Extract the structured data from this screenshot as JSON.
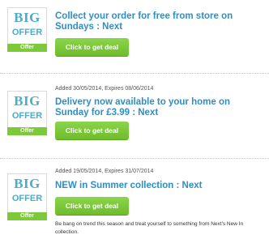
{
  "deals": [
    {
      "badge_big": "BIG",
      "badge_offer": "OFFER",
      "badge_tag": "Offer",
      "title": "Collect your order for free from store on Sundays : Next",
      "button": "Click to get deal"
    },
    {
      "badge_big": "BIG",
      "badge_offer": "OFFER",
      "badge_tag": "Offer",
      "meta": "Added 30/05/2014, Expires 08/06/2014",
      "title": "Delivery now available to your home on Sunday for £3.99 : Next",
      "button": "Click to get deal"
    },
    {
      "badge_big": "BIG",
      "badge_offer": "OFFER",
      "badge_tag": "Offer",
      "meta": "Added 19/05/2014, Expires 31/07/2014",
      "title": "NEW in Summer collection : Next",
      "button": "Click to get deal",
      "description": "Be bang on trend this season and treat yourself to something from Next's New In collection."
    }
  ],
  "colors": {
    "title": "#2e8fc4",
    "button": "#7cc93a",
    "badge_text": "#4aaecb"
  }
}
